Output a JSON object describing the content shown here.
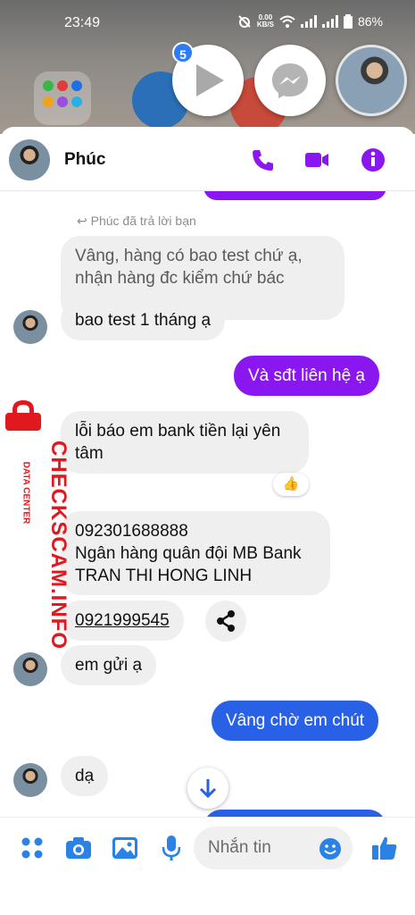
{
  "status_bar": {
    "time": "23:49",
    "net_speed": "0.00",
    "net_unit": "KB/S",
    "battery": "86%"
  },
  "chat_heads": {
    "badge_count": "5"
  },
  "header": {
    "contact_name": "Phúc"
  },
  "messages": {
    "reply_note": "Phúc đã trả lời bạn",
    "m1": "Vâng, hàng có bao test chứ ạ, nhận hàng đc kiểm chứ bác",
    "m2": "bao test 1 tháng ạ",
    "m3": "Và sđt liên hệ ạ",
    "m4": "lỗi báo em bank tiền lại yên tâm",
    "m4_reaction": "👍",
    "m5_line1": "092301688888",
    "m5_line2": "Ngân hàng quân đội MB Bank",
    "m5_line3": "TRAN THI HONG LINH",
    "m6": "0921999545",
    "m7": "em gửi ạ",
    "m8": "Vâng chờ em chút",
    "m9": "dạ"
  },
  "watermark": {
    "brand": "CHECKSCAM.INFO",
    "sub": "DATA CENTER"
  },
  "composer": {
    "placeholder": "Nhắn tin"
  },
  "colors": {
    "accent_purple": "#8b17f0",
    "bubble_blue": "#2860e6",
    "incoming_gray": "#efeff0"
  }
}
